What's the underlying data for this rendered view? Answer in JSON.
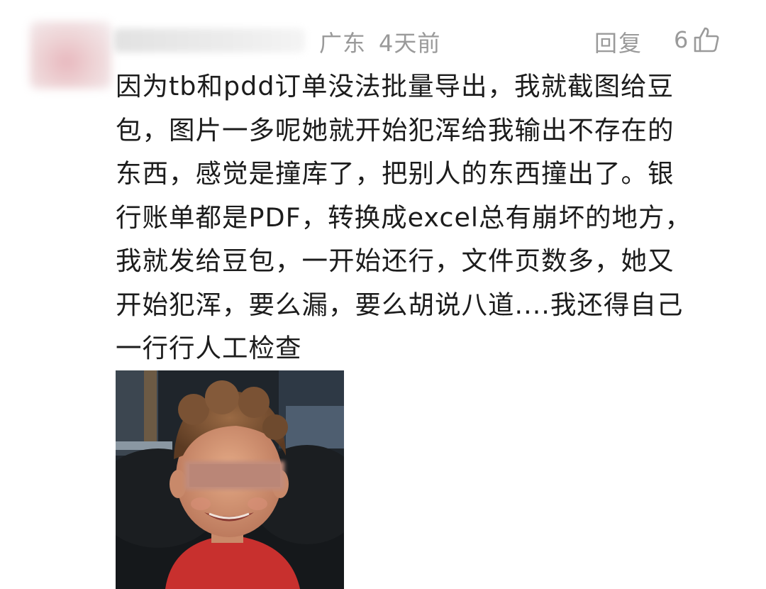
{
  "comment": {
    "location": "广东",
    "time": "4天前",
    "reply_label": "回复",
    "like_count": "6",
    "icons": {
      "like": "thumbs-up-icon"
    },
    "lines": [
      "因为tb和pdd订单没法批量导出，我就截图给豆",
      "包，图片一多呢她就开始犯浑给我输出不存在的",
      "东西，感觉是撞库了，把别人的东西撞出了。银",
      "行账单都是PDF，转换成excel总有崩坏的地方，",
      "我就发给豆包，一开始还行，文件页数多，她又",
      "开始犯浑，要么漏，要么胡说八道....我还得自己",
      "一行行人工检查"
    ]
  },
  "colors": {
    "meta_text": "#9a9a9a",
    "body_text": "#1c1c1c"
  }
}
